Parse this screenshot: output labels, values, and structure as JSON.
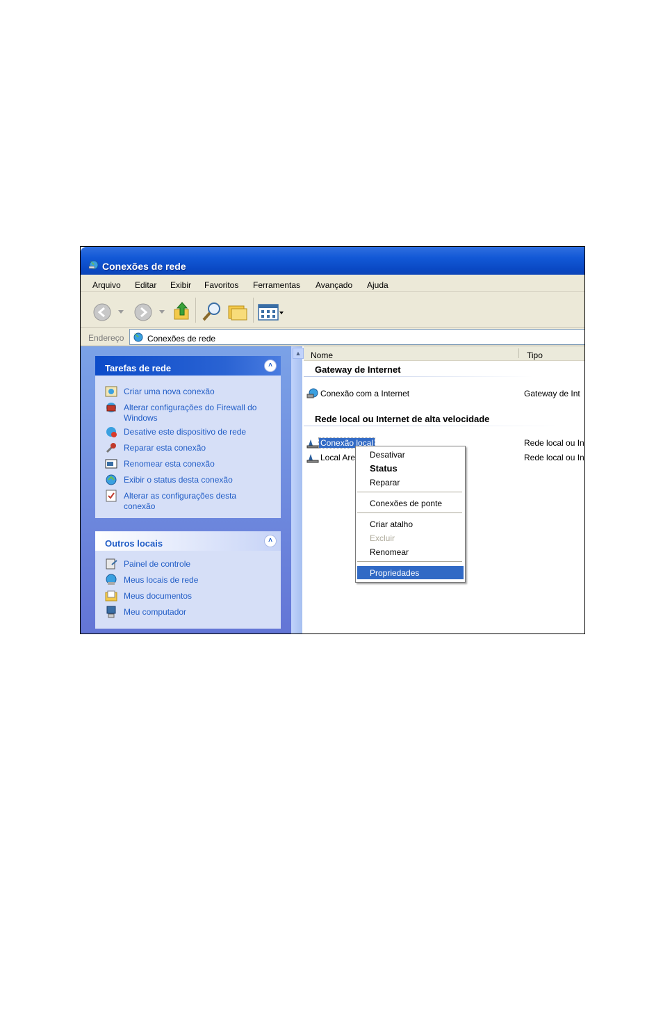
{
  "window": {
    "title": "Conexões de rede"
  },
  "menu": [
    "Arquivo",
    "Editar",
    "Exibir",
    "Favoritos",
    "Ferramentas",
    "Avançado",
    "Ajuda"
  ],
  "address": {
    "label": "Endereço",
    "value": "Conexões de rede"
  },
  "tasks_box": {
    "title": "Tarefas de rede",
    "items": [
      {
        "label": "Criar uma nova conexão",
        "icon": "new-connection-icon"
      },
      {
        "label": "Alterar configurações do Firewall do Windows",
        "icon": "firewall-icon"
      },
      {
        "label": "Desative este dispositivo de rede",
        "icon": "disable-network-icon"
      },
      {
        "label": "Reparar esta conexão",
        "icon": "repair-icon"
      },
      {
        "label": "Renomear esta conexão",
        "icon": "rename-icon"
      },
      {
        "label": "Exibir o status desta conexão",
        "icon": "status-icon"
      },
      {
        "label": "Alterar as configurações desta conexão",
        "icon": "settings-icon"
      }
    ]
  },
  "other_places_box": {
    "title": "Outros locais",
    "items": [
      {
        "label": "Painel de controle",
        "icon": "control-panel-icon"
      },
      {
        "label": "Meus locais de rede",
        "icon": "network-places-icon"
      },
      {
        "label": "Meus documentos",
        "icon": "documents-icon"
      },
      {
        "label": "Meu computador",
        "icon": "computer-icon"
      }
    ]
  },
  "columns": {
    "name": "Nome",
    "type": "Tipo"
  },
  "groups": [
    {
      "title": "Gateway de Internet",
      "items": [
        {
          "name": "Conexão com a Internet",
          "type": "Gateway de Int"
        }
      ]
    },
    {
      "title": "Rede local ou Internet de alta velocidade",
      "items": [
        {
          "name": "Conexão local",
          "type": "Rede local ou In"
        },
        {
          "name": "Local Are",
          "type": "Rede local ou In"
        }
      ]
    }
  ],
  "context_menu": {
    "items": [
      {
        "label": "Desativar"
      },
      {
        "label": "Status",
        "bold": true
      },
      {
        "label": "Reparar"
      },
      {
        "label": "Conexões de ponte"
      },
      {
        "label": "Criar atalho"
      },
      {
        "label": "Excluir",
        "disabled": true
      },
      {
        "label": "Renomear"
      },
      {
        "label": "Propriedades",
        "highlighted": true
      }
    ],
    "highlight_color": "#316ac5"
  },
  "colors": {
    "title_bar": "#0a49c4",
    "task_link": "#215dc6",
    "selection": "#316ac5"
  }
}
